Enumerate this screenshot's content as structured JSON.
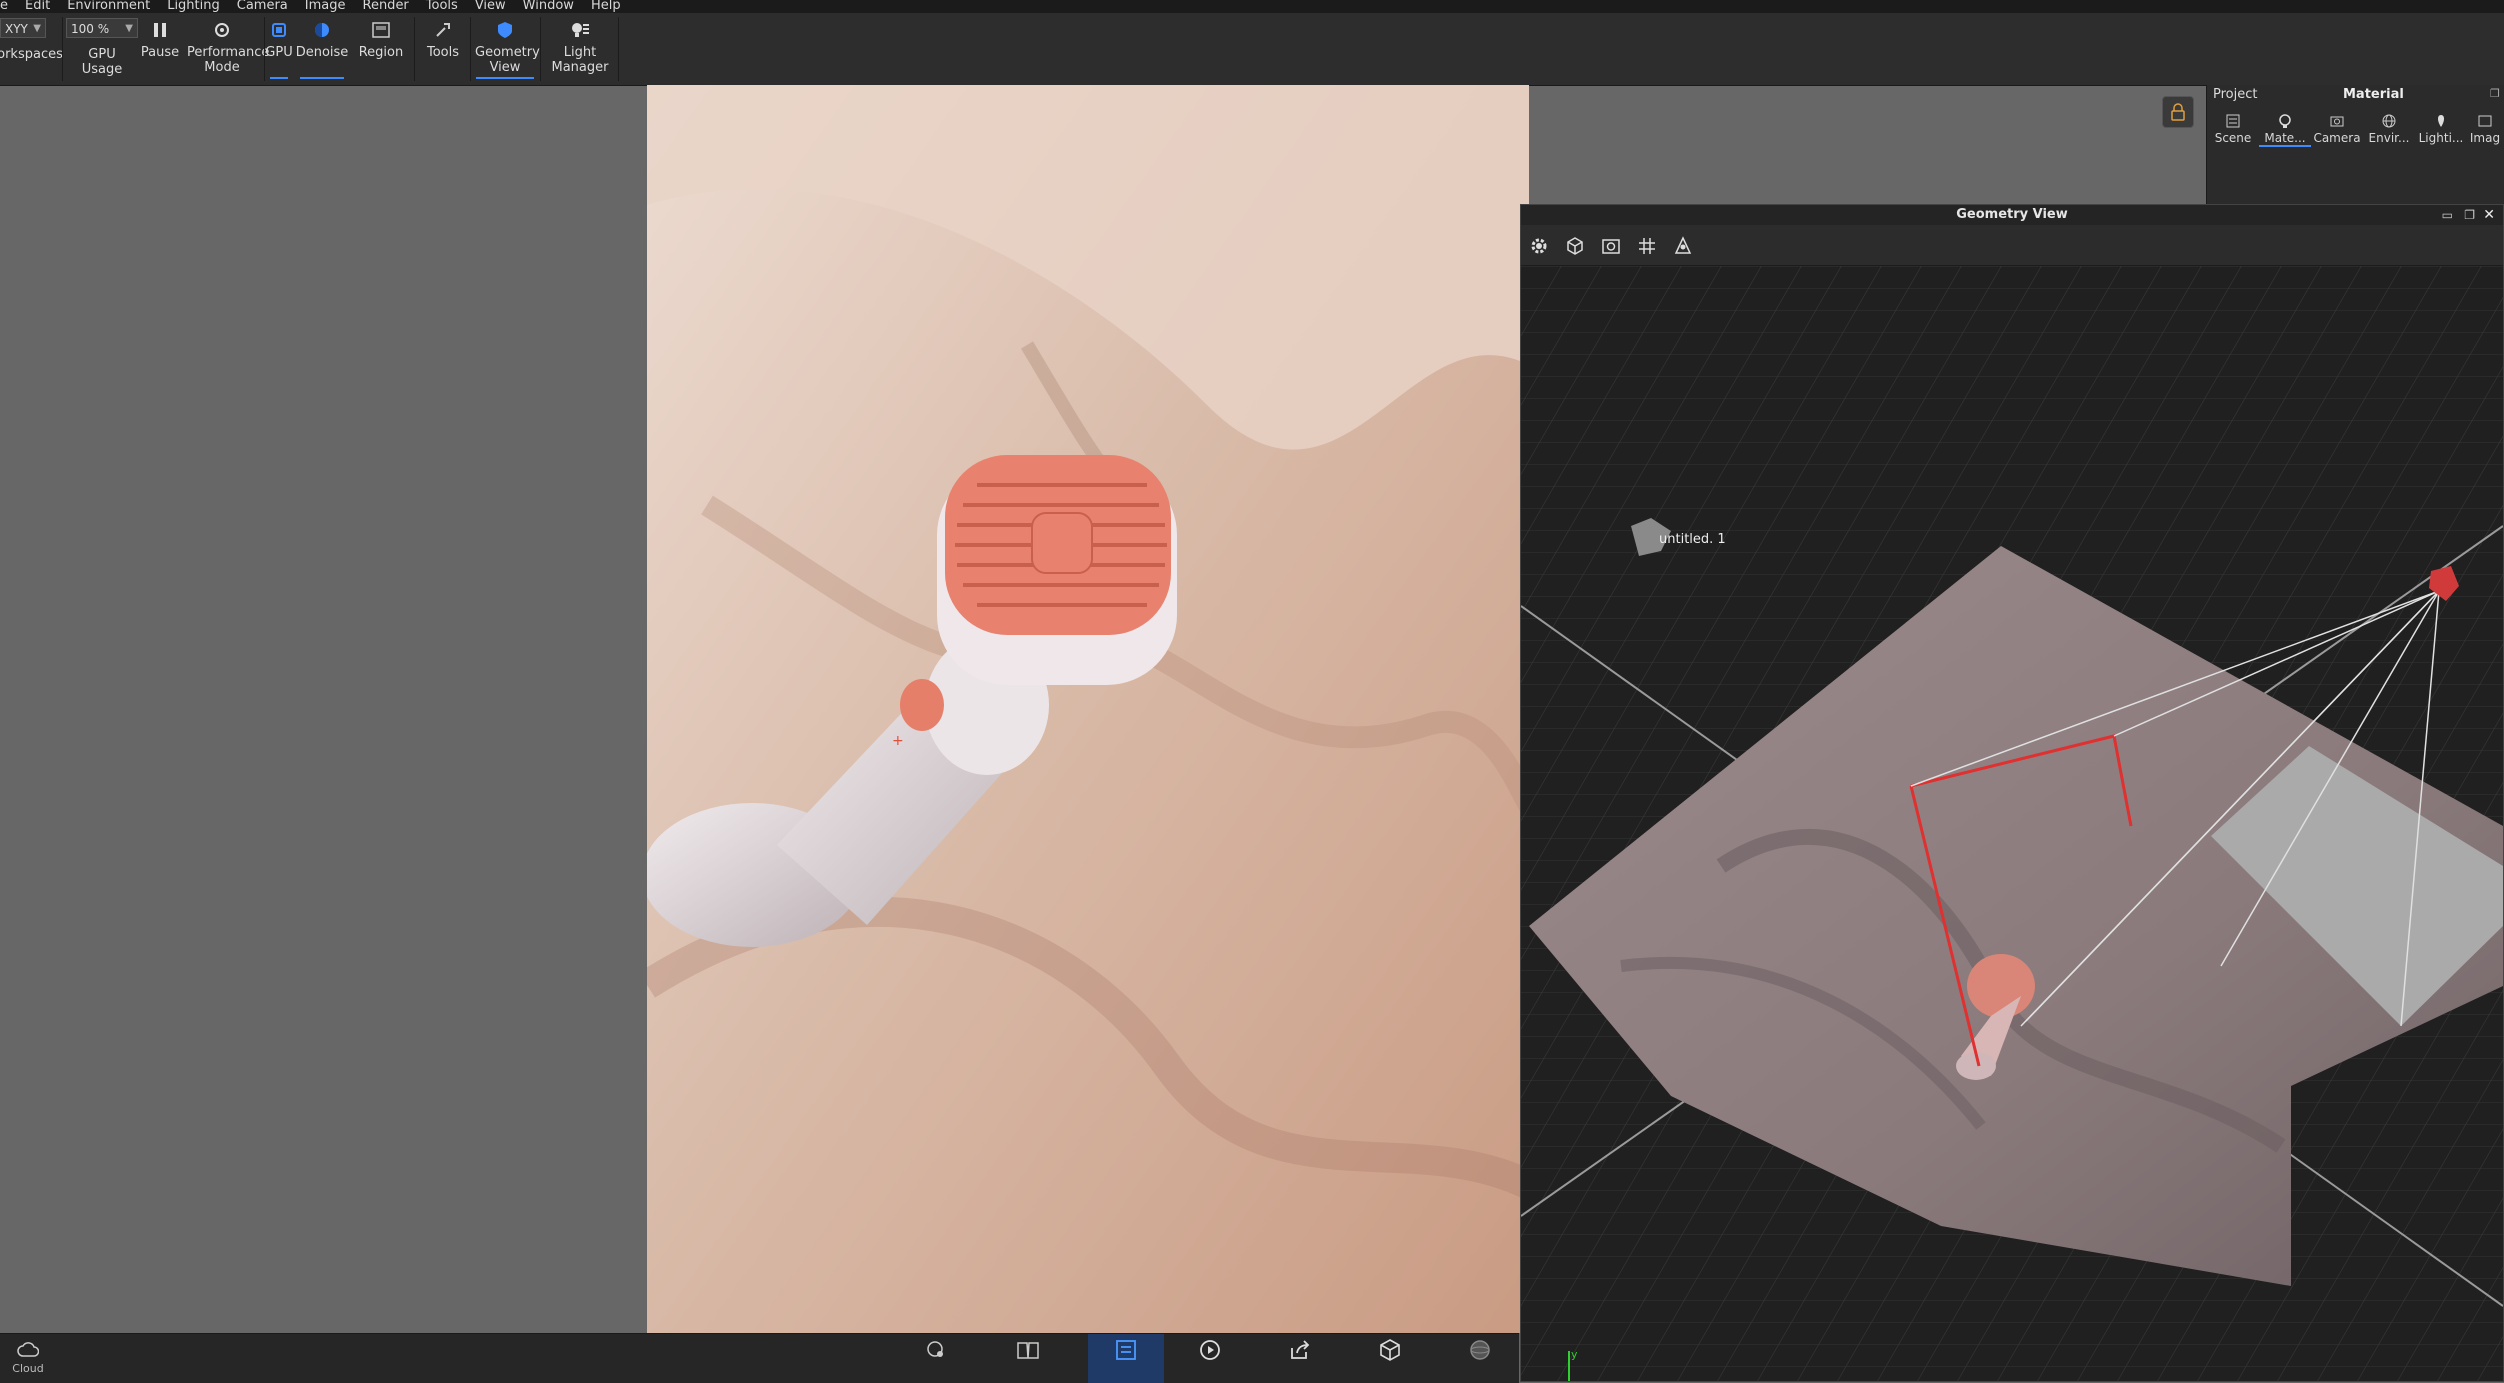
{
  "menu": [
    "e",
    "Edit",
    "Environment",
    "Lighting",
    "Camera",
    "Image",
    "Render",
    "Tools",
    "View",
    "Window",
    "Help"
  ],
  "toolbar": {
    "workspace_combo": "XYY",
    "workspaces_label": "orkspaces",
    "zoom_combo": "100 %",
    "gpu_usage": "GPU Usage",
    "pause": "Pause",
    "performance_mode": "Performance Mode",
    "gpu": "GPU",
    "denoise": "Denoise",
    "region": "Region",
    "tools": "Tools",
    "geometry_view": "Geometry View",
    "light_manager": "Light Manager"
  },
  "right_panel": {
    "project": "Project",
    "title": "Material",
    "tabs": [
      "Scene",
      "Mate...",
      "Camera",
      "Envir...",
      "Lighti...",
      "Imag"
    ]
  },
  "geometry_view": {
    "title": "Geometry View",
    "object_label": "untitled. 1",
    "axis_label": "y"
  },
  "bottom": {
    "cloud": "Cloud"
  },
  "colors": {
    "accent": "#3d8bff",
    "selection": "#e03030",
    "device_coral": "#e8826f"
  }
}
